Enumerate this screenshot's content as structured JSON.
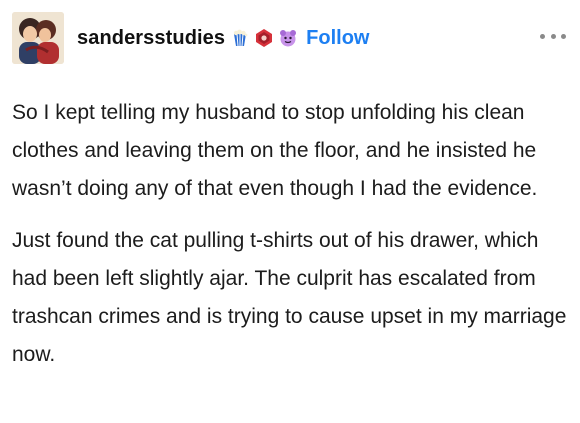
{
  "post": {
    "username": "sandersstudies",
    "follow_label": "Follow",
    "paragraphs": [
      "So I kept telling my husband to stop unfolding his clean clothes and leaving them on the floor, and he insisted he wasn’t doing any of that even though I had the evidence.",
      "Just found the cat pulling t-shirts out of his drawer, which had been left slightly ajar. The culprit has escalated from trashcan crimes and is trying to cause upset in my marriage now."
    ]
  },
  "icons": {
    "avatar": "avatar-illustration",
    "badges": [
      "popcorn-bucket-badge-icon",
      "red-badge-icon",
      "purple-crab-badge-icon"
    ],
    "more": "more-options-icon"
  },
  "colors": {
    "follow": "#1d7ff2",
    "text": "#1c1c1c",
    "muted": "#8a8a8a"
  }
}
